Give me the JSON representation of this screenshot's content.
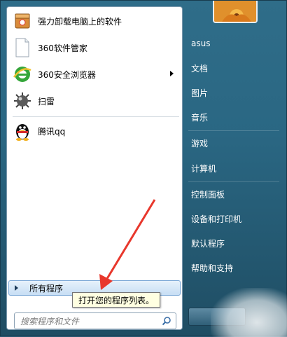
{
  "left_items": [
    {
      "label": "强力卸载电脑上的软件",
      "icon": "uninstall-box-icon"
    },
    {
      "label": "360软件管家",
      "icon": "blank-document-icon"
    },
    {
      "label": "360安全浏览器",
      "icon": "ie-browser-icon",
      "has_submenu": true
    },
    {
      "label": "扫雷",
      "icon": "minesweeper-icon"
    },
    {
      "label": "腾讯qq",
      "icon": "qq-penguin-icon"
    }
  ],
  "all_programs": "所有程序",
  "tooltip": "打开您的程序列表。",
  "search_placeholder": "搜索程序和文件",
  "right_items": [
    {
      "label": "asus"
    },
    {
      "label": "文档"
    },
    {
      "label": "图片"
    },
    {
      "label": "音乐"
    },
    {
      "label": "游戏"
    },
    {
      "label": "计算机"
    },
    {
      "label": "控制面板"
    },
    {
      "label": "设备和打印机"
    },
    {
      "label": "默认程序"
    },
    {
      "label": "帮助和支持"
    }
  ],
  "colors": {
    "annotation_arrow": "#e8372c",
    "right_panel": "#2a6783"
  }
}
